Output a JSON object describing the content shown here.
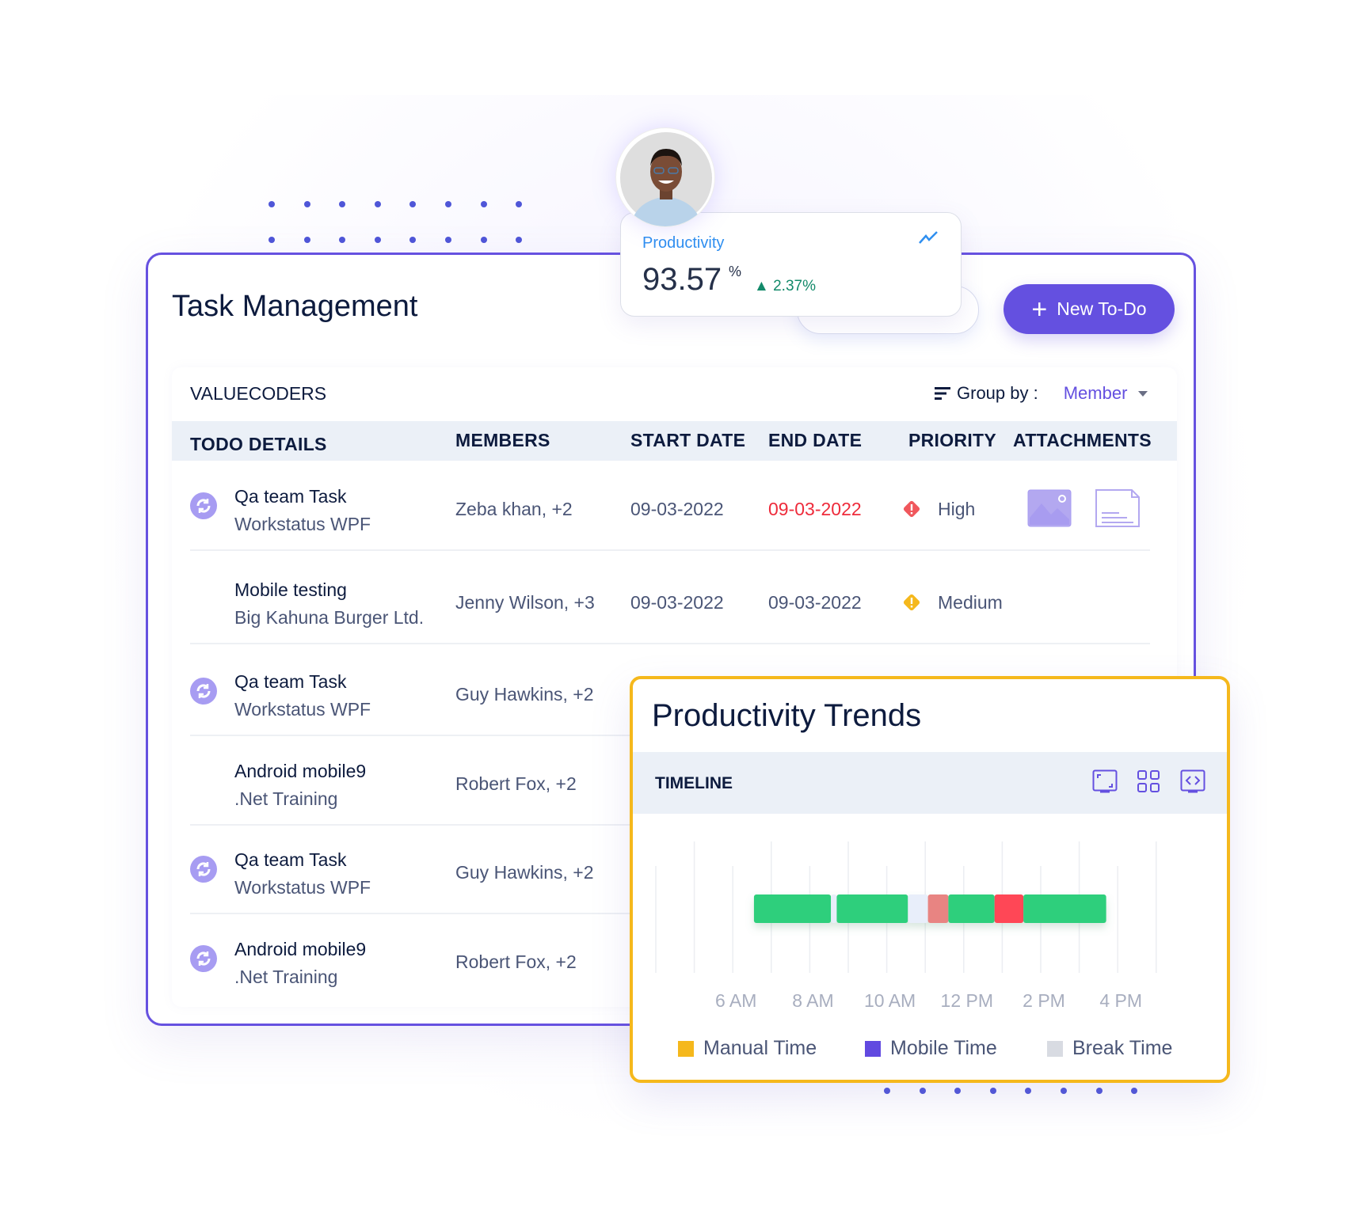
{
  "header": {
    "title": "Task Management",
    "new_button": "New To-Do"
  },
  "productivity": {
    "label": "Productivity",
    "value": "93.57",
    "unit": "%",
    "change": "2.37%",
    "change_direction": "up",
    "icon": "trend-line-icon"
  },
  "table": {
    "org": "VALUECODERS",
    "group_by_label": "Group by :",
    "group_by_value": "Member",
    "columns": [
      "TODO DETAILS",
      "MEMBERS",
      "START DATE",
      "END DATE",
      "PRIORITY",
      "ATTACHMENTS"
    ],
    "rows": [
      {
        "title": "Qa team Task",
        "project": "Workstatus WPF",
        "members": "Zeba khan, +2",
        "start": "09-03-2022",
        "end": "09-03-2022",
        "end_overdue": true,
        "priority": "High",
        "recurring": true,
        "attachments": [
          "image",
          "document"
        ]
      },
      {
        "title": "Mobile testing",
        "project": "Big Kahuna Burger Ltd.",
        "members": "Jenny Wilson, +3",
        "start": "09-03-2022",
        "end": "09-03-2022",
        "end_overdue": false,
        "priority": "Medium",
        "recurring": false,
        "attachments": []
      },
      {
        "title": "Qa team Task",
        "project": "Workstatus WPF",
        "members": "Guy Hawkins, +2",
        "recurring": true
      },
      {
        "title": "Android mobile9",
        "project": ".Net Training",
        "members": "Robert Fox, +2",
        "recurring": false
      },
      {
        "title": "Qa team Task",
        "project": "Workstatus WPF",
        "members": "Guy Hawkins, +2",
        "recurring": true
      },
      {
        "title": "Android mobile9",
        "project": ".Net Training",
        "members": "Robert Fox, +2",
        "recurring": true
      }
    ]
  },
  "colors": {
    "accent": "#6450e0",
    "trends_border": "#f5b81c",
    "high": "#f0575c",
    "medium": "#f5b81c",
    "overdue": "#ee2b3b"
  },
  "chart_data": {
    "type": "timeline",
    "title": "Productivity Trends",
    "section_label": "TIMELINE",
    "tick_labels": [
      "6 AM",
      "8 AM",
      "10 AM",
      "12 PM",
      "2 PM",
      "4 PM"
    ],
    "x_range_hours": [
      4,
      17
    ],
    "segments": [
      {
        "start": 6.55,
        "end": 8.55,
        "color": "#2ecf7c"
      },
      {
        "start": 8.55,
        "end": 8.7,
        "color": "#e8eefa"
      },
      {
        "start": 8.7,
        "end": 10.55,
        "color": "#2ecf7c"
      },
      {
        "start": 10.55,
        "end": 11.07,
        "color": "#e8eefa"
      },
      {
        "start": 11.07,
        "end": 11.6,
        "color": "#e88482"
      },
      {
        "start": 11.6,
        "end": 12.8,
        "color": "#2ecf7c"
      },
      {
        "start": 12.8,
        "end": 13.55,
        "color": "#ff4757"
      },
      {
        "start": 13.55,
        "end": 15.7,
        "color": "#2ecf7c"
      }
    ],
    "legend": [
      {
        "name": "Manual Time",
        "color": "#f5b81c"
      },
      {
        "name": "Mobile Time",
        "color": "#6149e0"
      },
      {
        "name": "Break Time",
        "color": "#d8dbe2"
      }
    ],
    "toolbar_icons": [
      "fullscreen-icon",
      "grid-icon",
      "embed-icon"
    ]
  }
}
